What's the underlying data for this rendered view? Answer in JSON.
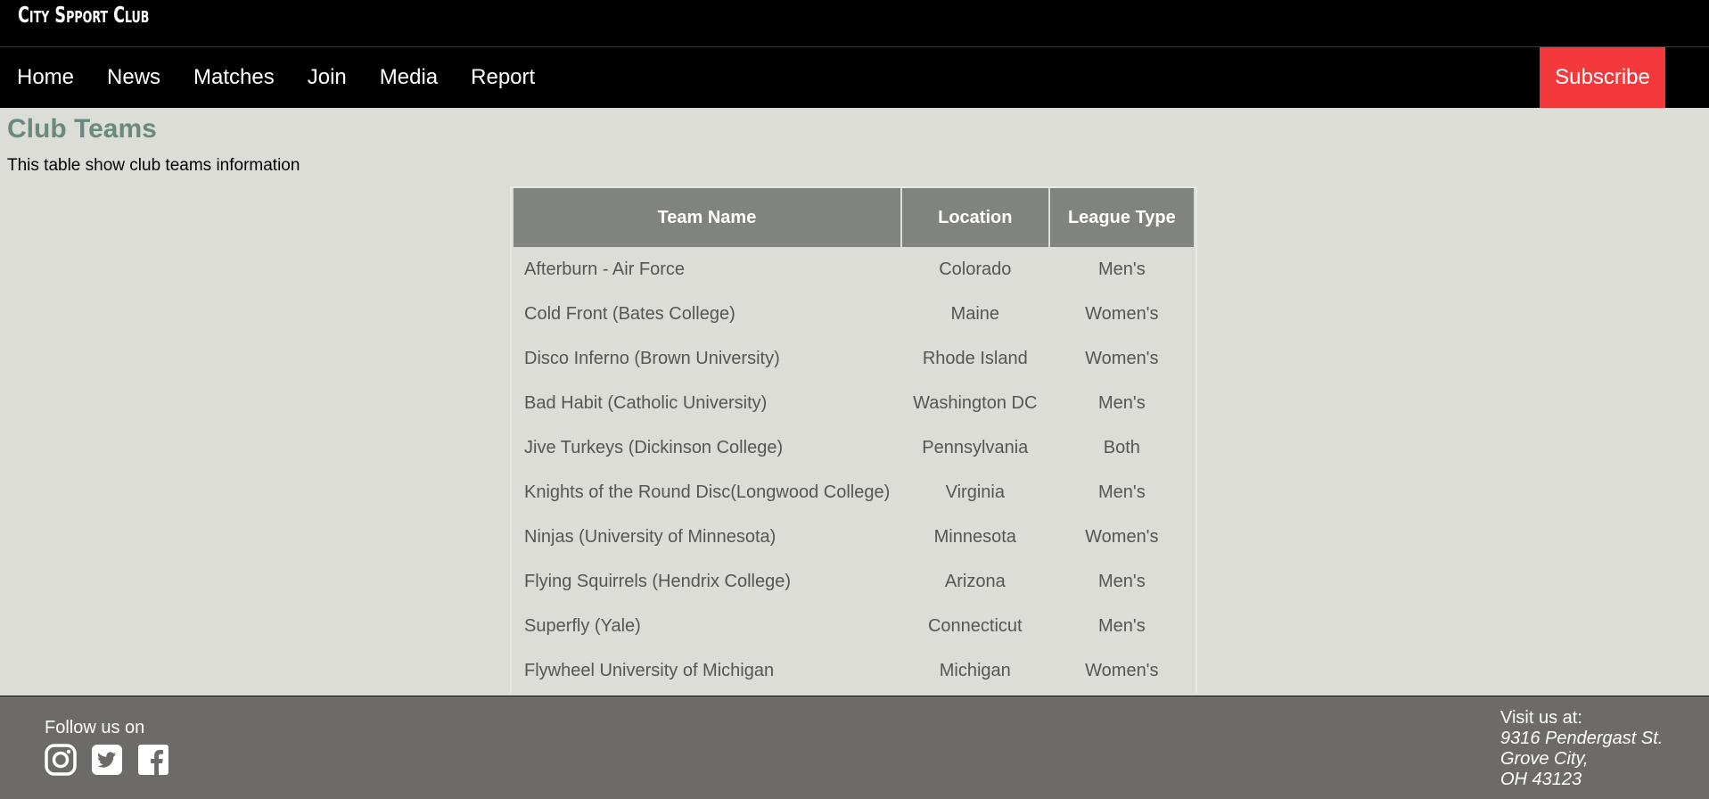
{
  "brand": {
    "logo_text": "City Spport Club"
  },
  "nav": {
    "items": [
      "Home",
      "News",
      "Matches",
      "Join",
      "Media",
      "Report"
    ],
    "subscribe_label": "Subscribe",
    "subscribe_color": "#f4393c"
  },
  "main": {
    "title": "Club Teams",
    "description": "This table show club teams information",
    "table": {
      "headers": [
        "Team Name",
        "Location",
        "League Type"
      ],
      "rows": [
        [
          "Afterburn - Air Force",
          "Colorado",
          "Men's"
        ],
        [
          "Cold Front (Bates College)",
          "Maine",
          "Women's"
        ],
        [
          "Disco Inferno (Brown University)",
          "Rhode Island",
          "Women's"
        ],
        [
          "Bad Habit (Catholic University)",
          "Washington DC",
          "Men's"
        ],
        [
          "Jive Turkeys (Dickinson College)",
          "Pennsylvania",
          "Both"
        ],
        [
          "Knights of the Round Disc(Longwood College)",
          "Virginia",
          "Men's"
        ],
        [
          "Ninjas (University of Minnesota)",
          "Minnesota",
          "Women's"
        ],
        [
          "Flying Squirrels (Hendrix College)",
          "Arizona",
          "Men's"
        ],
        [
          "Superfly (Yale)",
          "Connecticut",
          "Men's"
        ],
        [
          "Flywheel University of Michigan",
          "Michigan",
          "Women's"
        ]
      ]
    }
  },
  "footer": {
    "follow_label": "Follow us on",
    "social_icons": [
      "instagram-icon",
      "twitter-icon",
      "facebook-icon"
    ],
    "visit_label": "Visit us at:",
    "address_lines": [
      "9316 Pendergast St.",
      "Grove City,",
      "OH 43123"
    ]
  }
}
